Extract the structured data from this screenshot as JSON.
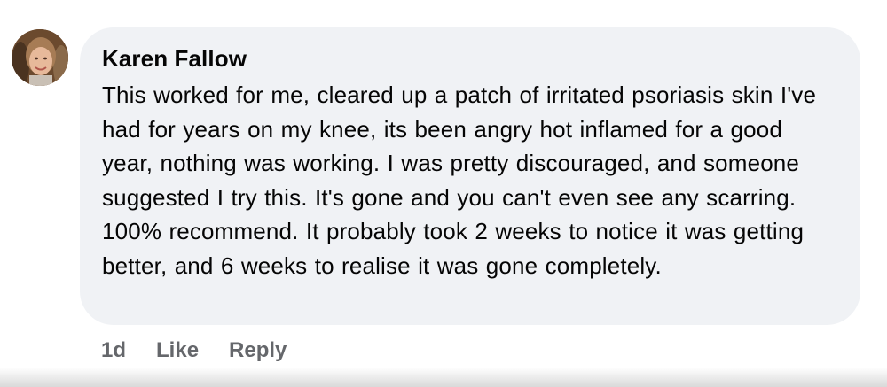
{
  "comment": {
    "author": "Karen Fallow",
    "text": "This worked for me, cleared up a patch of irritated psoriasis skin I've had for years on my knee, its been angry hot inflamed for a good year, nothing was working. I was pretty discouraged, and someone suggested I try this. It's gone and you can't even see any scarring. 100% recommend. It probably took 2 weeks to notice it was getting better, and 6 weeks to realise it was gone completely.",
    "timestamp": "1d",
    "like_label": "Like",
    "reply_label": "Reply"
  },
  "colors": {
    "bubble_background": "#f0f2f5",
    "text": "#050505",
    "secondary_text": "#65676b"
  }
}
